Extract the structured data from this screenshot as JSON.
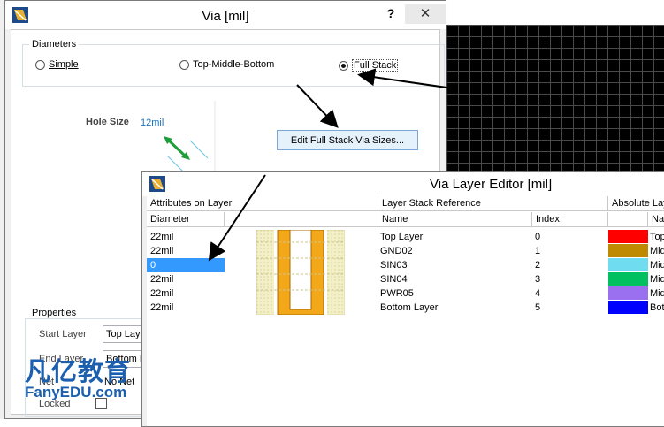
{
  "via_dialog": {
    "title": "Via [mil]",
    "help": "?",
    "close": "✕",
    "diameters_group": "Diameters",
    "radio_simple": "Simple",
    "radio_tmb": "Top-Middle-Bottom",
    "radio_full": "Full Stack",
    "selected": "Full Stack",
    "hole_size_label": "Hole Size",
    "hole_size_value": "12mil",
    "edit_button": "Edit Full Stack Via Sizes...",
    "properties_group": "Properties",
    "start_layer_label": "Start Layer",
    "start_layer_value": "Top Layer",
    "end_layer_label": "End Layer",
    "end_layer_value": "Bottom Layer",
    "net_label": "Net",
    "net_value": "No Net",
    "locked_label": "Locked"
  },
  "layer_editor": {
    "title": "Via Layer Editor [mil]",
    "section_attributes": "Attributes on Layer",
    "section_stack": "Layer Stack Reference",
    "section_absolute": "Absolute Lay",
    "col_diameter": "Diameter",
    "col_name": "Name",
    "col_index": "Index",
    "col_abs_name": "Na",
    "rows": [
      {
        "diameter": "22mil",
        "name": "Top Layer",
        "index": "0",
        "color": "#ff0000",
        "abs": "Top"
      },
      {
        "diameter": "22mil",
        "name": "GND02",
        "index": "1",
        "color": "#c08a00",
        "abs": "Mid"
      },
      {
        "diameter": "0",
        "name": "SIN03",
        "index": "2",
        "color": "#6fdcf0",
        "abs": "Mid"
      },
      {
        "diameter": "22mil",
        "name": "SIN04",
        "index": "3",
        "color": "#00c060",
        "abs": "Mid"
      },
      {
        "diameter": "22mil",
        "name": "PWR05",
        "index": "4",
        "color": "#9a70f0",
        "abs": "Mid"
      },
      {
        "diameter": "22mil",
        "name": "Bottom Layer",
        "index": "5",
        "color": "#0000ff",
        "abs": "Bot"
      }
    ],
    "selected_row": 2
  },
  "watermark": {
    "cn": "凡亿教育",
    "en": "FanyEDU.com"
  }
}
